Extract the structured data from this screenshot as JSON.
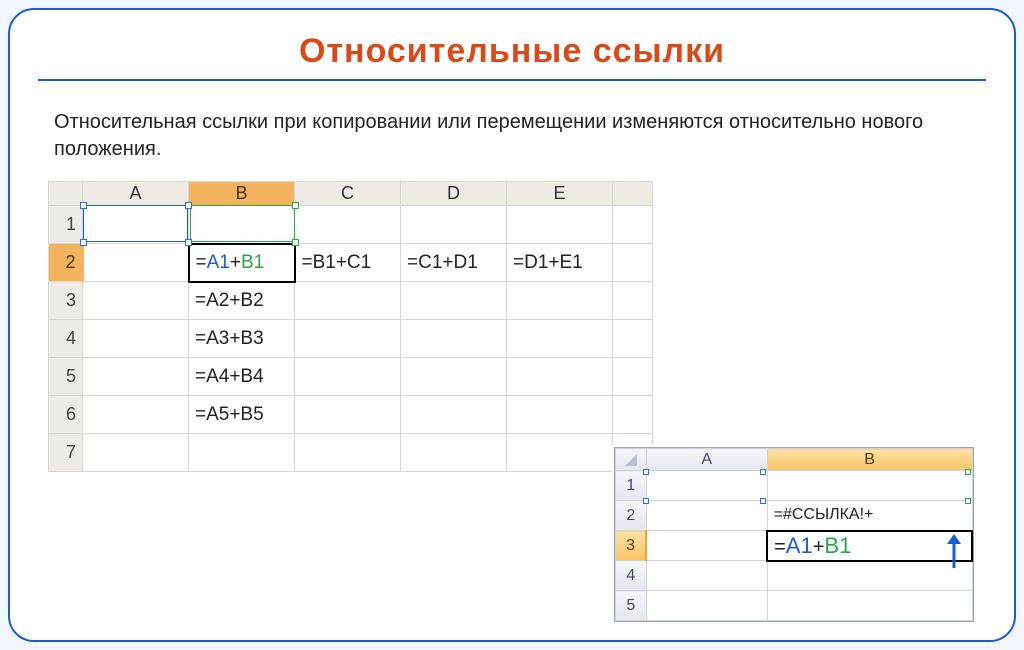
{
  "title": "Относительные ссылки",
  "description": "Относительная ссылки при копировании или перемещении изменяются относительно нового положения.",
  "colors": {
    "title": "#d94a1a",
    "accent": "#1b5dd1",
    "colSelect": "#f4b45f",
    "refA": "#1b5dd1",
    "refB": "#2aa646"
  },
  "mainSheet": {
    "columns": [
      "A",
      "B",
      "C",
      "D",
      "E"
    ],
    "rows": [
      "1",
      "2",
      "3",
      "4",
      "5",
      "6",
      "7"
    ],
    "selectedColumn": "B",
    "selectedRow": "2",
    "activeCell": "B2",
    "activeRefs": {
      "a": "A1",
      "b": "B1"
    },
    "cells": {
      "B2": {
        "eq": "=",
        "a": "A1",
        "op": "+",
        "b": "B1"
      },
      "C2": "=B1+C1",
      "D2": "=C1+D1",
      "E2": "=D1+E1",
      "B3": "=A2+B2",
      "B4": "=A3+B3",
      "B5": "=A4+B4",
      "B6": "=A5+B5"
    }
  },
  "miniSheet": {
    "columns": [
      "A",
      "B"
    ],
    "rows": [
      "1",
      "2",
      "3",
      "4",
      "5"
    ],
    "selectedColumn": "B",
    "selectedRow": "3",
    "activeCell": "B3",
    "cells": {
      "B2": "=#ССЫЛКА!+",
      "B3": {
        "eq": "=",
        "a": "A1",
        "op": "+",
        "b": "B1"
      }
    },
    "arrowDirection": "up"
  }
}
